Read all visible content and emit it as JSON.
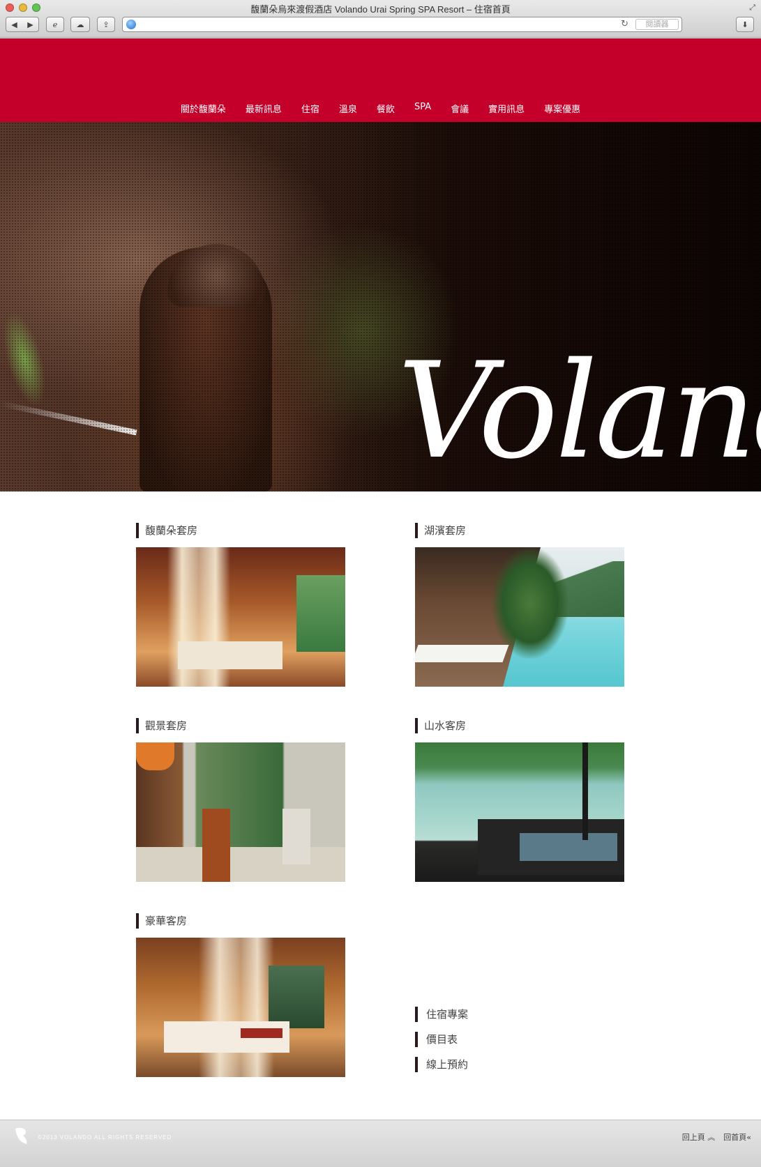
{
  "browser": {
    "window_title": "馥蘭朵烏來渡假酒店 Volando Urai Spring SPA Resort – 住宿首頁",
    "reader_label": "閱讀器"
  },
  "nav": {
    "items": [
      "關於馥蘭朵",
      "最新訊息",
      "住宿",
      "溫泉",
      "餐飲",
      "SPA",
      "會議",
      "實用訊息",
      "專案優惠"
    ]
  },
  "hero": {
    "logo_text": "Volando"
  },
  "rooms": [
    {
      "title": "馥蘭朵套房"
    },
    {
      "title": "湖濱套房"
    },
    {
      "title": "觀景套房"
    },
    {
      "title": "山水客房"
    },
    {
      "title": "豪華客房"
    }
  ],
  "side_links": [
    "住宿專案",
    "價目表",
    "線上預約"
  ],
  "footer": {
    "copyright": "©2013 VOLANDO ALL RIGHTS RESERVED",
    "prev_page": "回上頁",
    "home_page": "回首頁"
  },
  "colors": {
    "header_red": "#c4002a",
    "accent_bar": "#2a1a1a"
  }
}
